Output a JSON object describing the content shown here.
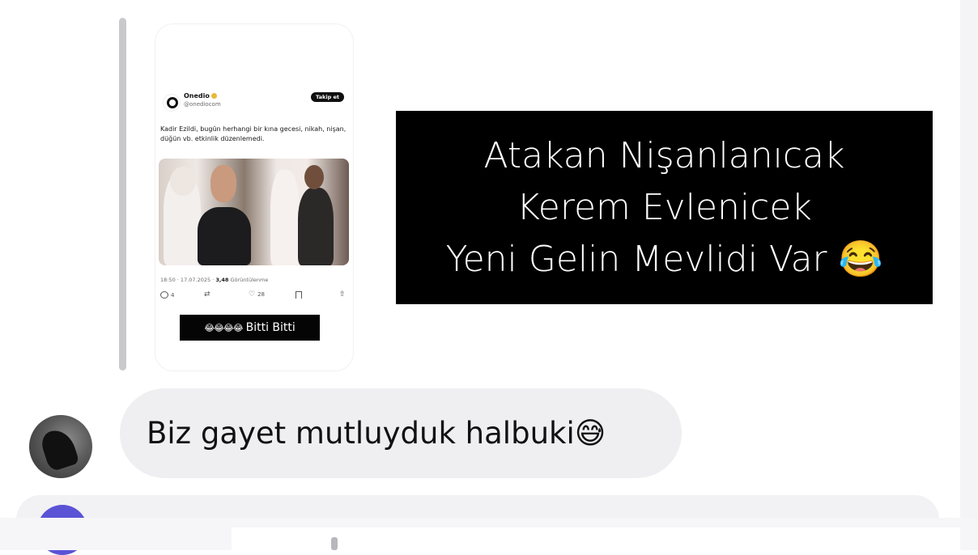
{
  "story": {
    "tweet": {
      "name": "Onedio",
      "handle": "@onediocom",
      "follow_label": "Takip et",
      "text": "Kadir Ezildi, bugün herhangi bir kına gecesi, nikah, nişan, düğün vb. etkinlik düzenlemedi.",
      "timestamp": "18:50 · 17.07.2025 · ",
      "views": "3,48",
      "views_label": " Görüntülenme",
      "replies": "4",
      "likes": "28",
      "accent_color": "#e8b93a"
    },
    "caption_emojis": "😂😂😂😂",
    "caption_text": "Bitti Bitti"
  },
  "overlay": {
    "line1": "Atakan Nişanlanıcak",
    "line2": "Kerem Evlenicek",
    "line3": "Yeni Gelin Mevlidi Var 😂"
  },
  "message": {
    "text": "Biz gayet mutluyduk halbuki😅"
  },
  "colors": {
    "bubble": "#efeff1",
    "reply_bar": "#c9c9cc",
    "overlay_bg": "#000000",
    "next_avatar": "#5b53d6"
  }
}
